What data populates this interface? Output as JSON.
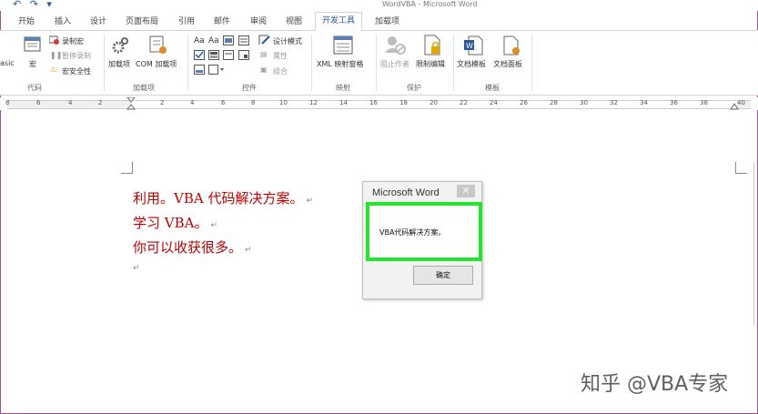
{
  "window": {
    "title": "WordVBA - Microsoft Word"
  },
  "tabs": [
    {
      "label": "开始"
    },
    {
      "label": "插入"
    },
    {
      "label": "设计"
    },
    {
      "label": "页面布局"
    },
    {
      "label": "引用"
    },
    {
      "label": "邮件"
    },
    {
      "label": "审阅"
    },
    {
      "label": "视图"
    },
    {
      "label": "开发工具"
    },
    {
      "label": "加载项"
    }
  ],
  "ribbon": {
    "code": {
      "group_label": "代码",
      "basic": "asic",
      "macros": "宏",
      "record": "录制宏",
      "pause": "暂停录制",
      "security": "宏安全性"
    },
    "addins": {
      "group_label": "加载项",
      "addins": "加载项",
      "com": "COM 加载项"
    },
    "controls": {
      "group_label": "控件",
      "aa1": "Aa",
      "aa2": "Aa",
      "design": "设计模式",
      "props": "属性",
      "group": "组合"
    },
    "mapping": {
      "group_label": "映射",
      "xml": "XML 映射窗格"
    },
    "protect": {
      "group_label": "保护",
      "block": "阻止作者",
      "restrict": "限制编辑"
    },
    "templates": {
      "group_label": "模板",
      "doc_template": "文档模板",
      "doc_panel": "文档面板"
    }
  },
  "ruler": [
    "8",
    "6",
    "4",
    "2",
    "2",
    "4",
    "6",
    "8",
    "10",
    "12",
    "14",
    "16",
    "18",
    "20",
    "22",
    "24",
    "26",
    "28",
    "30",
    "32",
    "34",
    "36",
    "38",
    "40"
  ],
  "document": {
    "lines": [
      "利用。VBA 代码解决方案。",
      "学习 VBA。",
      "你可以收获很多。"
    ],
    "para_mark": "↵"
  },
  "dialog": {
    "title": "Microsoft Word",
    "close": "✕",
    "message": "VBA代码解决方案。",
    "ok": "确定"
  },
  "watermark": "知乎 @VBA专家"
}
